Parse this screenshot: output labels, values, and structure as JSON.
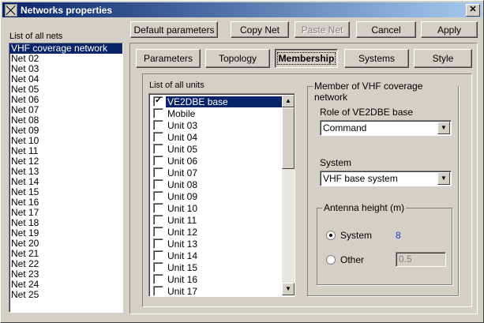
{
  "window": {
    "title": "Networks properties",
    "close_label": "✕"
  },
  "nets_panel": {
    "label": "List of all nets",
    "items": [
      "VHF coverage network",
      "Net 02",
      "Net 03",
      "Net 04",
      "Net 05",
      "Net 06",
      "Net 07",
      "Net 08",
      "Net 09",
      "Net 10",
      "Net 11",
      "Net 12",
      "Net 13",
      "Net 14",
      "Net 15",
      "Net 16",
      "Net 17",
      "Net 18",
      "Net 19",
      "Net 20",
      "Net 21",
      "Net 22",
      "Net 23",
      "Net 24",
      "Net 25"
    ],
    "selected": "VHF coverage network"
  },
  "toolbar": {
    "default_parameters": "Default parameters",
    "copy_net": "Copy Net",
    "paste_net": "Paste Net",
    "cancel": "Cancel",
    "apply": "Apply"
  },
  "tabs": {
    "parameters": "Parameters",
    "topology": "Topology",
    "membership": "Membership",
    "systems": "Systems",
    "style": "Style",
    "active": "Membership"
  },
  "units_panel": {
    "label": "List of all units",
    "items": [
      {
        "name": "VE2DBE base",
        "checked": true,
        "selected": true
      },
      {
        "name": "Mobile",
        "checked": false
      },
      {
        "name": "Unit 03",
        "checked": false
      },
      {
        "name": "Unit 04",
        "checked": false
      },
      {
        "name": "Unit 05",
        "checked": false
      },
      {
        "name": "Unit 06",
        "checked": false
      },
      {
        "name": "Unit 07",
        "checked": false
      },
      {
        "name": "Unit 08",
        "checked": false
      },
      {
        "name": "Unit 09",
        "checked": false
      },
      {
        "name": "Unit 10",
        "checked": false
      },
      {
        "name": "Unit 11",
        "checked": false
      },
      {
        "name": "Unit 12",
        "checked": false
      },
      {
        "name": "Unit 13",
        "checked": false
      },
      {
        "name": "Unit 14",
        "checked": false
      },
      {
        "name": "Unit 15",
        "checked": false
      },
      {
        "name": "Unit 16",
        "checked": false
      },
      {
        "name": "Unit 17",
        "checked": false
      }
    ]
  },
  "member_group": {
    "title": "Member of VHF coverage network",
    "role_label": "Role of VE2DBE base",
    "role_value": "Command",
    "system_label": "System",
    "system_value": "VHF base system",
    "antenna_group": {
      "title": "Antenna height (m)",
      "system_option": "System",
      "system_value": "8",
      "other_option": "Other",
      "other_value": "0.5",
      "selected": "System"
    }
  },
  "colors": {
    "selection": "#0a246a",
    "face": "#d4d0c8",
    "value_blue": "#2040c0"
  }
}
